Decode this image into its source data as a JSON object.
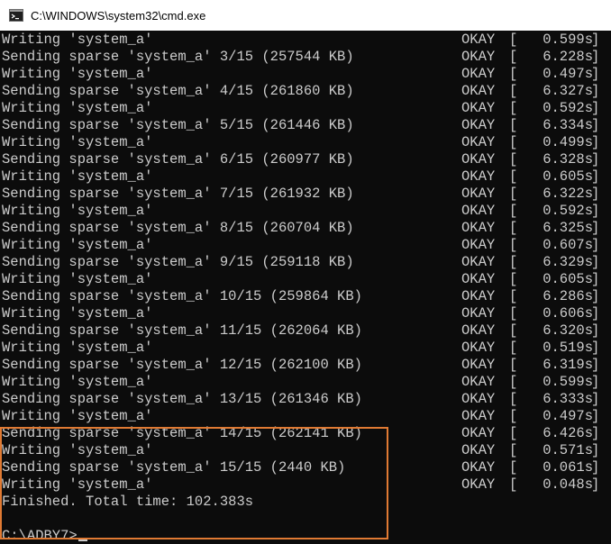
{
  "window": {
    "title": "C:\\WINDOWS\\system32\\cmd.exe",
    "icon": "cmd-icon"
  },
  "log": [
    {
      "msg": "Writing 'system_a'",
      "status": "OKAY",
      "time": "0.599s"
    },
    {
      "msg": "Sending sparse 'system_a' 3/15 (257544 KB)",
      "status": "OKAY",
      "time": "6.228s"
    },
    {
      "msg": "Writing 'system_a'",
      "status": "OKAY",
      "time": "0.497s"
    },
    {
      "msg": "Sending sparse 'system_a' 4/15 (261860 KB)",
      "status": "OKAY",
      "time": "6.327s"
    },
    {
      "msg": "Writing 'system_a'",
      "status": "OKAY",
      "time": "0.592s"
    },
    {
      "msg": "Sending sparse 'system_a' 5/15 (261446 KB)",
      "status": "OKAY",
      "time": "6.334s"
    },
    {
      "msg": "Writing 'system_a'",
      "status": "OKAY",
      "time": "0.499s"
    },
    {
      "msg": "Sending sparse 'system_a' 6/15 (260977 KB)",
      "status": "OKAY",
      "time": "6.328s"
    },
    {
      "msg": "Writing 'system_a'",
      "status": "OKAY",
      "time": "0.605s"
    },
    {
      "msg": "Sending sparse 'system_a' 7/15 (261932 KB)",
      "status": "OKAY",
      "time": "6.322s"
    },
    {
      "msg": "Writing 'system_a'",
      "status": "OKAY",
      "time": "0.592s"
    },
    {
      "msg": "Sending sparse 'system_a' 8/15 (260704 KB)",
      "status": "OKAY",
      "time": "6.325s"
    },
    {
      "msg": "Writing 'system_a'",
      "status": "OKAY",
      "time": "0.607s"
    },
    {
      "msg": "Sending sparse 'system_a' 9/15 (259118 KB)",
      "status": "OKAY",
      "time": "6.329s"
    },
    {
      "msg": "Writing 'system_a'",
      "status": "OKAY",
      "time": "0.605s"
    },
    {
      "msg": "Sending sparse 'system_a' 10/15 (259864 KB)",
      "status": "OKAY",
      "time": "6.286s"
    },
    {
      "msg": "Writing 'system_a'",
      "status": "OKAY",
      "time": "0.606s"
    },
    {
      "msg": "Sending sparse 'system_a' 11/15 (262064 KB)",
      "status": "OKAY",
      "time": "6.320s"
    },
    {
      "msg": "Writing 'system_a'",
      "status": "OKAY",
      "time": "0.519s"
    },
    {
      "msg": "Sending sparse 'system_a' 12/15 (262100 KB)",
      "status": "OKAY",
      "time": "6.319s"
    },
    {
      "msg": "Writing 'system_a'",
      "status": "OKAY",
      "time": "0.599s"
    },
    {
      "msg": "Sending sparse 'system_a' 13/15 (261346 KB)",
      "status": "OKAY",
      "time": "6.333s"
    },
    {
      "msg": "Writing 'system_a'",
      "status": "OKAY",
      "time": "0.497s"
    },
    {
      "msg": "Sending sparse 'system_a' 14/15 (262141 KB)",
      "status": "OKAY",
      "time": "6.426s"
    },
    {
      "msg": "Writing 'system_a'",
      "status": "OKAY",
      "time": "0.571s"
    },
    {
      "msg": "Sending sparse 'system_a' 15/15 (2440 KB)",
      "status": "OKAY",
      "time": "0.061s"
    },
    {
      "msg": "Writing 'system_a'",
      "status": "OKAY",
      "time": "0.048s"
    }
  ],
  "bracket_open": "[",
  "bracket_close": "]",
  "finished": "Finished. Total time: 102.383s",
  "prompt": "C:\\ADBY7>",
  "colors": {
    "text": "#cccccc",
    "background": "#0c0c0c",
    "highlight": "#e07a33"
  }
}
